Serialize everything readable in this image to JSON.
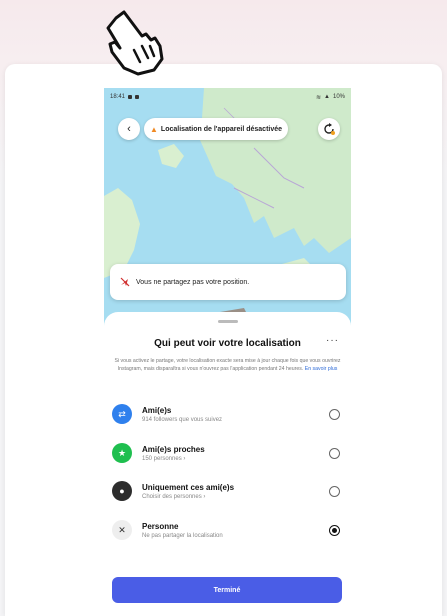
{
  "status_bar": {
    "time": "18:41",
    "battery": "10%"
  },
  "top_bar": {
    "location_status": "Localisation de l'appareil désactivée"
  },
  "banner": {
    "text": "Vous ne partagez pas votre position."
  },
  "sheet": {
    "title": "Qui peut voir votre localisation",
    "more_label": "···",
    "description": "Si vous activez le partage, votre localisation exacte sera mise à jour chaque fois que vous ouvrirez Instagram, mais disparaîtra si vous n'ouvrez pas l'application pendant 24 heures.",
    "learn_more": "En savoir plus",
    "options": [
      {
        "title": "Ami(e)s",
        "subtitle": "914 followers que vous suivez",
        "icon": "friends-icon",
        "color": "#2f80ed",
        "selected": false
      },
      {
        "title": "Ami(e)s proches",
        "subtitle": "150 personnes ›",
        "icon": "star-icon",
        "color": "#1fbf4f",
        "selected": false
      },
      {
        "title": "Uniquement ces ami(e)s",
        "subtitle": "Choisir des personnes ›",
        "icon": "person-icon",
        "color": "#2d2d2d",
        "selected": false
      },
      {
        "title": "Personne",
        "subtitle": "Ne pas partager la localisation",
        "icon": "location-off-icon",
        "color": "#eeeeee",
        "selected": true
      }
    ],
    "done_label": "Terminé"
  },
  "colors": {
    "accent": "#4a5de6",
    "map_water": "#a6ddf1",
    "map_land": "#cfeacb"
  }
}
